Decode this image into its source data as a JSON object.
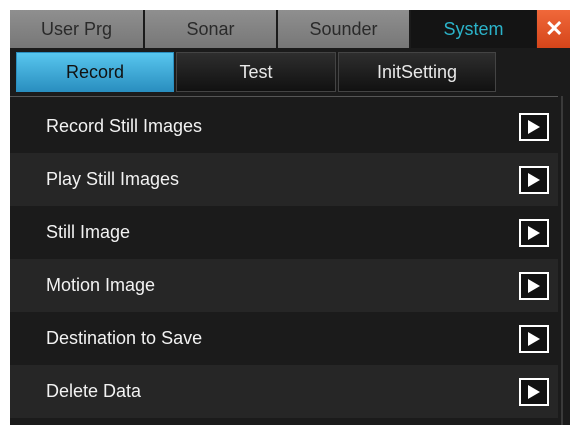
{
  "top_tabs": [
    {
      "label": "User Prg",
      "active": false
    },
    {
      "label": "Sonar",
      "active": false
    },
    {
      "label": "Sounder",
      "active": false
    },
    {
      "label": "System",
      "active": true
    }
  ],
  "close_icon": "close-icon",
  "sub_tabs": [
    {
      "label": "Record",
      "active": true
    },
    {
      "label": "Test",
      "active": false
    },
    {
      "label": "InitSetting",
      "active": false
    }
  ],
  "menu": {
    "items": [
      {
        "label": "Record Still Images",
        "icon": "play-arrow-icon"
      },
      {
        "label": "Play Still Images",
        "icon": "play-arrow-icon"
      },
      {
        "label": "Still Image",
        "icon": "play-arrow-icon"
      },
      {
        "label": "Motion Image",
        "icon": "play-arrow-icon"
      },
      {
        "label": "Destination to Save",
        "icon": "play-arrow-icon"
      },
      {
        "label": "Delete Data",
        "icon": "play-arrow-icon"
      }
    ]
  },
  "colors": {
    "accent_active_tab_text": "#2bb3c9",
    "active_subtab": "#3fa9d9",
    "close_button": "#e0552a"
  }
}
